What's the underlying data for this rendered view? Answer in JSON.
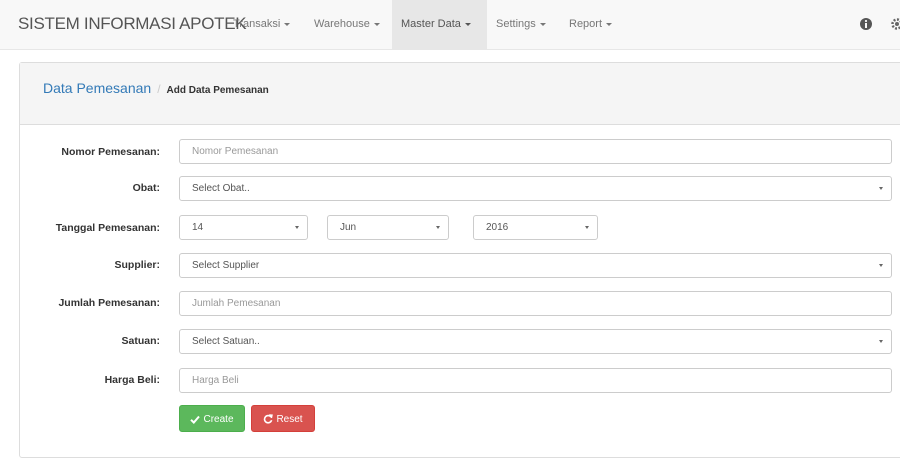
{
  "navbar": {
    "brand": "SISTEM INFORMASI APOTEK",
    "menus": [
      {
        "label": "Transaksi"
      },
      {
        "label": "Warehouse"
      },
      {
        "label": "Master Data"
      },
      {
        "label": "Settings"
      },
      {
        "label": "Report"
      }
    ],
    "active_menu": "Master Data",
    "icons": [
      "info-icon",
      "gear-icon"
    ]
  },
  "breadcrumb": {
    "parent": "Data Pemesanan",
    "separator": "/",
    "current": "Add Data Pemesanan"
  },
  "form": {
    "nomor": {
      "label": "Nomor Pemesanan:",
      "placeholder": "Nomor Pemesanan"
    },
    "obat": {
      "label": "Obat:",
      "value": "Select Obat.."
    },
    "tanggal": {
      "label": "Tanggal Pemesanan:",
      "day": "14",
      "month": "Jun",
      "year": "2016"
    },
    "supplier": {
      "label": "Supplier:",
      "value": "Select Supplier"
    },
    "jumlah": {
      "label": "Jumlah Pemesanan:",
      "placeholder": "Jumlah Pemesanan"
    },
    "satuan": {
      "label": "Satuan:",
      "value": "Select Satuan.."
    },
    "harga": {
      "label": "Harga Beli:",
      "placeholder": "Harga Beli"
    }
  },
  "buttons": {
    "create": "Create",
    "reset": "Reset"
  },
  "colors": {
    "primary_link": "#337ab7",
    "create_button": "#5cb85c",
    "reset_button": "#d9534f",
    "navbar_bg": "#f8f8f8"
  }
}
